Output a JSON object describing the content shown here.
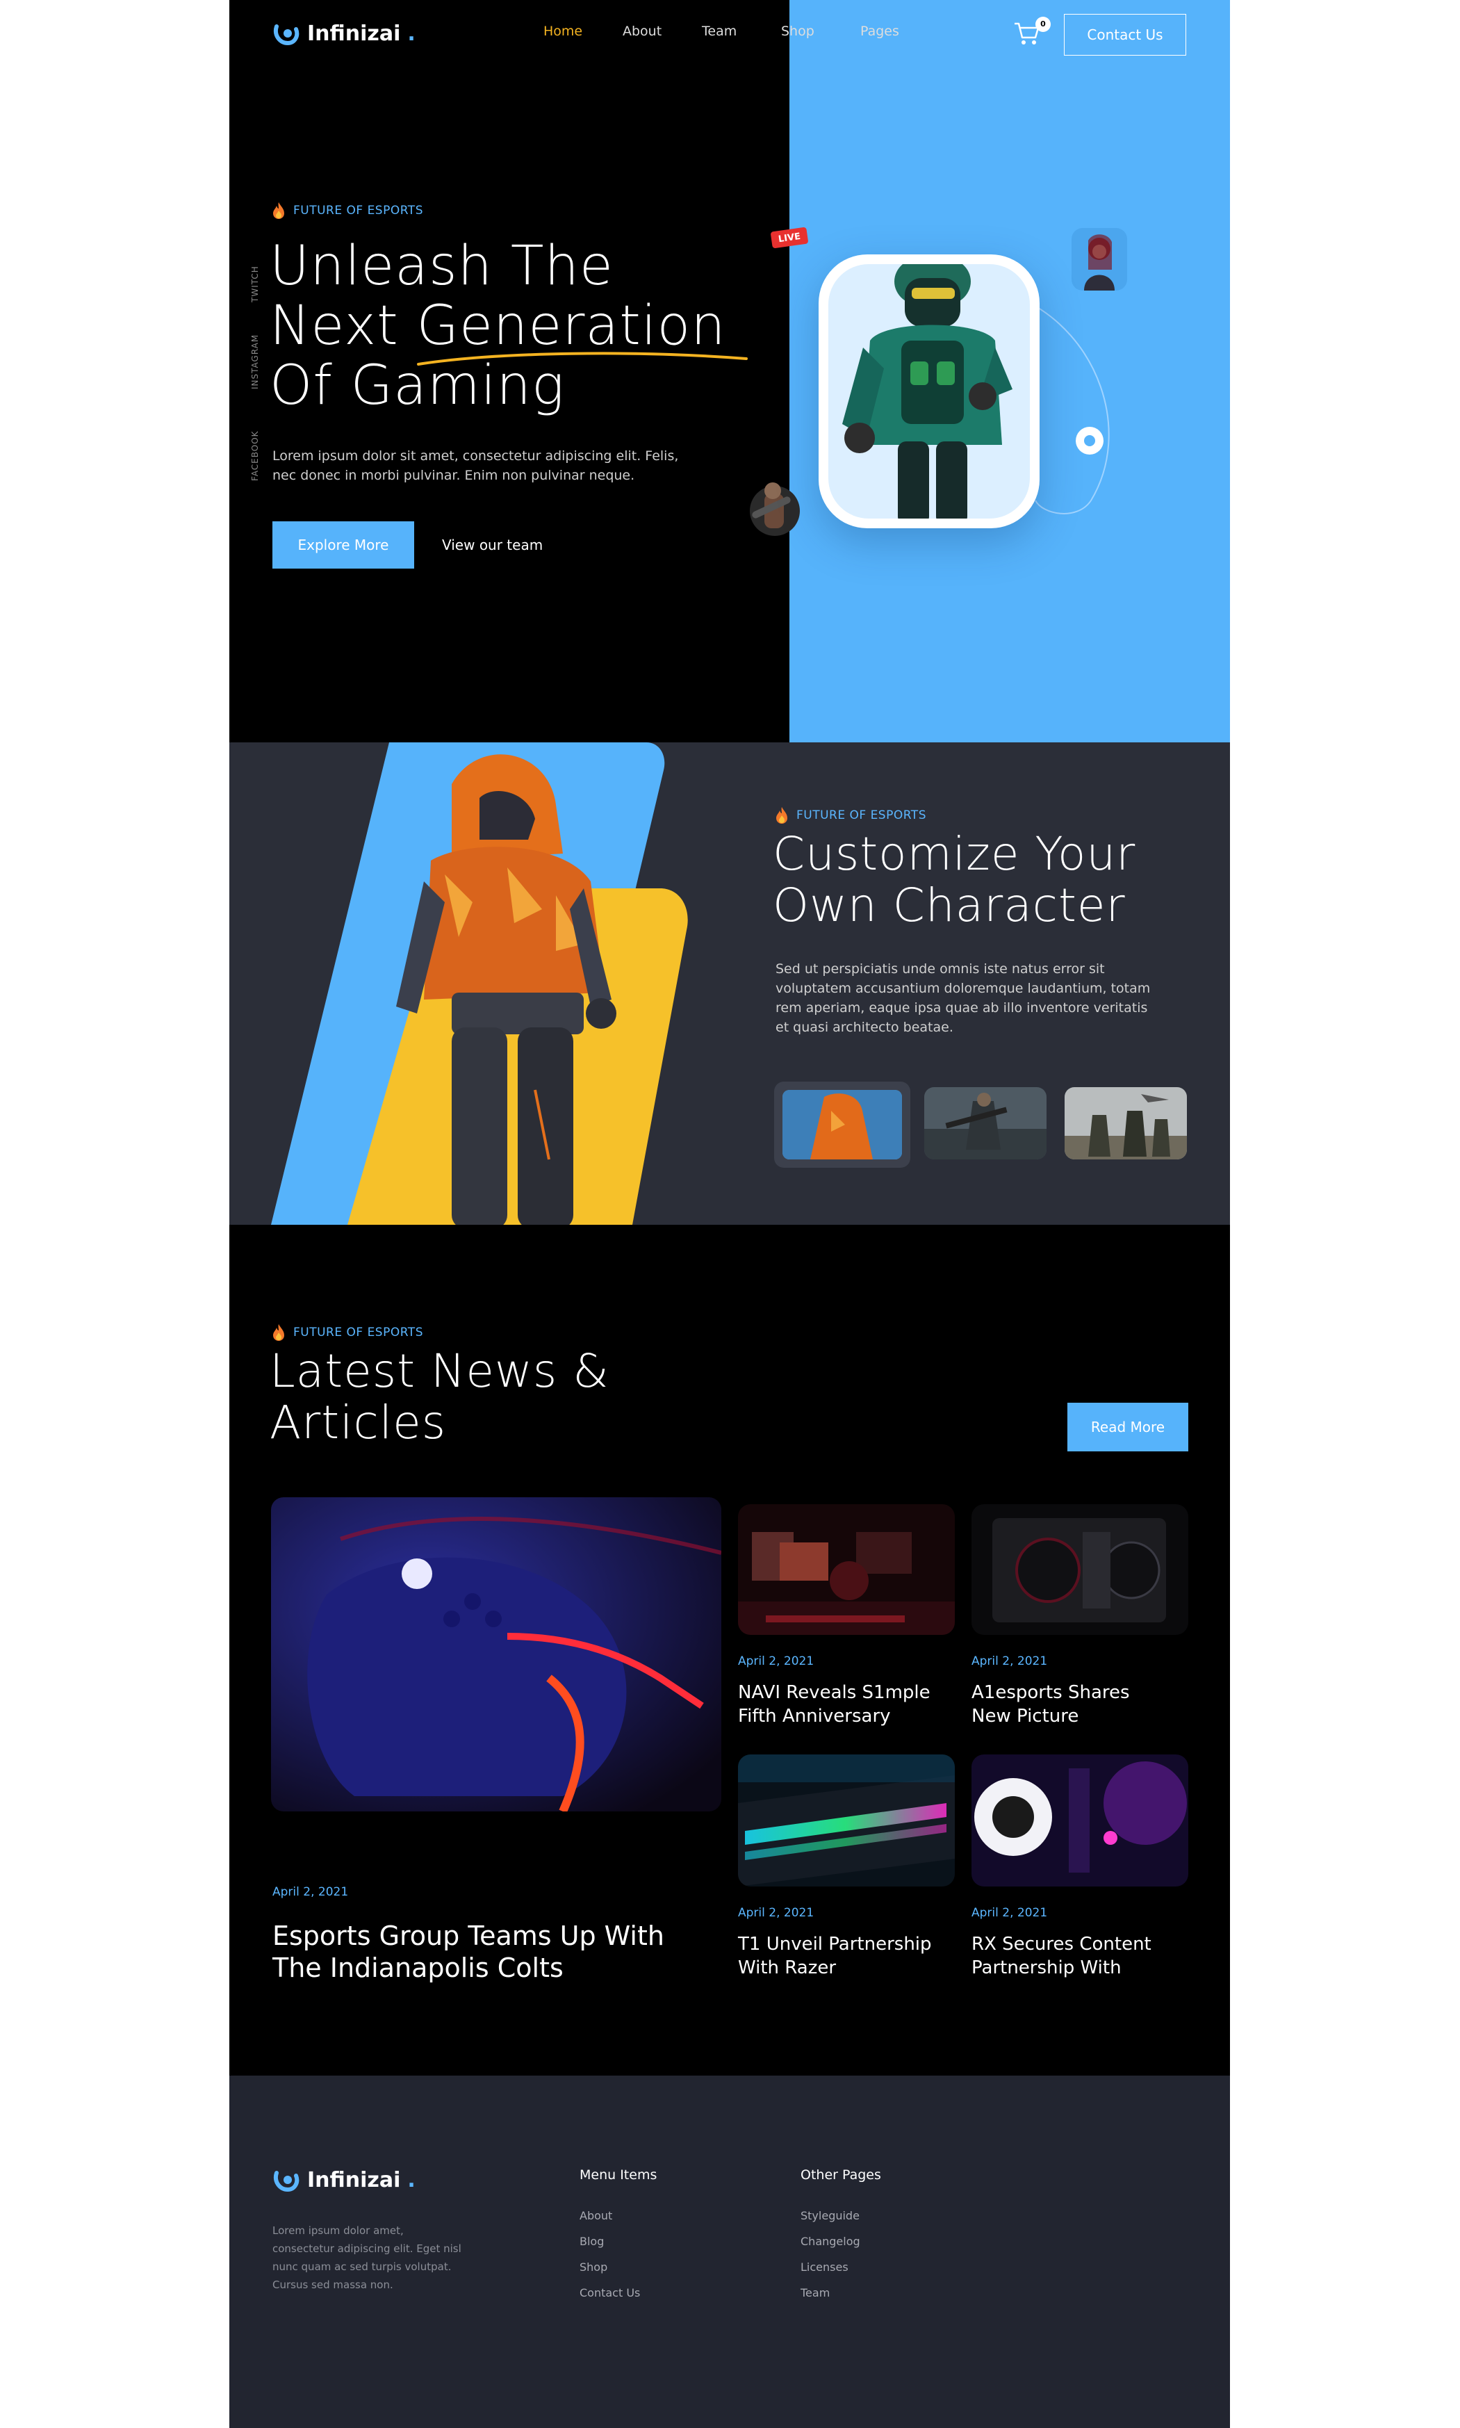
{
  "header": {
    "brand": "Infinizai",
    "brand_dot": ".",
    "nav": [
      "Home",
      "About",
      "Team",
      "Shop",
      "Pages"
    ],
    "active_nav": "Home",
    "cart_count": "0",
    "contact_label": "Contact Us"
  },
  "hero": {
    "eyebrow": "FUTURE OF ESPORTS",
    "title_line1": "Unleash The",
    "title_line2": "Next Generation",
    "title_line3": "Of Gaming",
    "description": "Lorem ipsum dolor sit amet, consectetur adipiscing elit. Felis, nec donec in morbi pulvinar. Enim non pulvinar neque.",
    "primary_button": "Explore More",
    "secondary_link": "View our team",
    "social": [
      "TWITCH",
      "INSTAGRAM",
      "FACEBOOK"
    ],
    "live_badge": "LIVE"
  },
  "customize": {
    "eyebrow": "FUTURE OF ESPORTS",
    "title_line1": "Customize Your",
    "title_line2": "Own Character",
    "description": "Sed ut perspiciatis unde omnis iste natus error sit voluptatem accusantium doloremque laudantium, totam rem aperiam, eaque ipsa quae ab illo inventore veritatis et quasi architecto beatae."
  },
  "news": {
    "eyebrow": "FUTURE OF ESPORTS",
    "title_line1": "Latest News &",
    "title_line2": "Articles",
    "read_more": "Read More",
    "featured": {
      "date": "April 2, 2021",
      "title_line1": "Esports Group Teams Up With",
      "title_line2": "The Indianapolis Colts"
    },
    "articles": [
      {
        "date": "April 2, 2021",
        "title_line1": "NAVI Reveals S1mple",
        "title_line2": "Fifth Anniversary"
      },
      {
        "date": "April 2, 2021",
        "title_line1": "A1esports Shares",
        "title_line2": "New Picture"
      },
      {
        "date": "April 2, 2021",
        "title_line1": "T1 Unveil Partnership",
        "title_line2": "With Razer"
      },
      {
        "date": "April 2, 2021",
        "title_line1": "RX Secures Content",
        "title_line2": "Partnership With"
      }
    ]
  },
  "footer": {
    "brand": "Infinizai",
    "brand_dot": ".",
    "about": "Lorem ipsum dolor amet, consectetur adipiscing elit. Eget nisl nunc quam ac sed turpis volutpat. Cursus sed massa non.",
    "menu_title": "Menu Items",
    "menu_items": [
      "About",
      "Blog",
      "Shop",
      "Contact Us"
    ],
    "other_title": "Other Pages",
    "other_items": [
      "Styleguide",
      "Changelog",
      "Licenses",
      "Team"
    ]
  },
  "colors": {
    "accent_blue": "#56b3fb",
    "accent_yellow": "#f4b321",
    "background": "#000000",
    "panel": "#2b2e38",
    "footer": "#222530"
  }
}
